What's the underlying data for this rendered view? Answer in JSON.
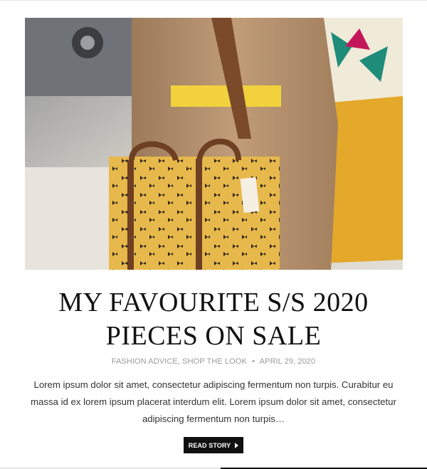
{
  "post": {
    "title_line1": "MY FAVOURITE S/S 2020",
    "title_line2": "PIECES ON SALE",
    "category1": "FASHION ADVICE",
    "category2": "SHOP THE LOOK",
    "separator": "•",
    "date": "APRIL 29, 2020",
    "excerpt": "Lorem ipsum dolor sit amet, consectetur adipiscing fermentum non turpis. Curabitur eu massa id ex lorem ipsum placerat interdum elit. Lorem ipsum dolor sit amet, consectetur adipiscing fermentum non turpis…",
    "read_label": "READ STORY",
    "image_subject": "tan trench coat with yellow bee-print tote bag"
  },
  "colors": {
    "title": "#111111",
    "meta": "#9a9a9a",
    "button_bg": "#111111",
    "button_text": "#ffffff",
    "mustard": "#e8b530",
    "coat": "#b99572",
    "leather": "#7a4a2a"
  }
}
